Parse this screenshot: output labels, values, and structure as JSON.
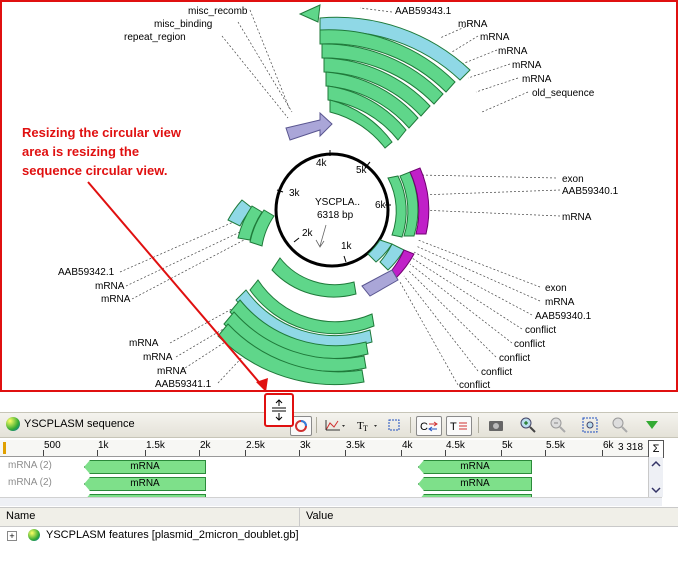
{
  "circular_view": {
    "center_title": "YSCPLA..",
    "center_length": "6318 bp",
    "ring_ticks": [
      "4k",
      "5k",
      "3k",
      "6k",
      "2k",
      "1k"
    ],
    "labels_top_left": [
      "misc_recomb",
      "misc_binding",
      "repeat_region"
    ],
    "labels_top_right": [
      "AAB59343.1",
      "mRNA",
      "mRNA",
      "mRNA",
      "mRNA",
      "mRNA",
      "old_sequence"
    ],
    "labels_right_mid": [
      "exon",
      "AAB59340.1",
      "mRNA"
    ],
    "labels_left_mid": [
      "AAB59342.1",
      "mRNA",
      "mRNA"
    ],
    "labels_bottom_left": [
      "mRNA",
      "mRNA",
      "mRNA",
      "AAB59341.1"
    ],
    "labels_bottom_right": [
      "exon",
      "mRNA",
      "AAB59340.1",
      "conflict",
      "conflict",
      "conflict",
      "conflict",
      "conflict"
    ],
    "annotation_lines": [
      "Resizing the circular view",
      "area is resizing the",
      "sequence circular view."
    ],
    "colors": {
      "feature_green": "#5fd68a",
      "feature_teal": "#8fd8e6",
      "exon_magenta": "#c020c8",
      "repeat_lavender": "#aaa6d8",
      "highlight_red": "#e01010"
    }
  },
  "toolbar": {
    "sequence_name": "YSCPLASM sequence",
    "icons": [
      "circular-view-icon",
      "graphs-icon",
      "text-format-icon",
      "select-area-icon",
      "complement-icon",
      "translation-icon",
      "camera-icon",
      "zoom-in-icon",
      "zoom-out-icon",
      "zoom-fit-icon",
      "zoom-reset-icon",
      "collapse-icon"
    ]
  },
  "ruler": {
    "ticks": [
      "1",
      "500",
      "1k",
      "1.5k",
      "2k",
      "2.5k",
      "3k",
      "3.5k",
      "4k",
      "4.5k",
      "5k",
      "5.5k",
      "6k",
      "3 318"
    ]
  },
  "tracks": [
    {
      "label": "mRNA (2)",
      "features": [
        {
          "text": "mRNA"
        },
        {
          "text": "mRNA"
        }
      ]
    },
    {
      "label": "mRNA (2)",
      "features": [
        {
          "text": "mRNA"
        },
        {
          "text": "mRNA"
        }
      ]
    },
    {
      "label": "",
      "features": [
        {
          "text": ""
        },
        {
          "text": ""
        }
      ]
    }
  ],
  "features_panel": {
    "columns": [
      "Name",
      "Value"
    ],
    "root_item": "YSCPLASM features [plasmid_2micron_doublet.gb]"
  }
}
